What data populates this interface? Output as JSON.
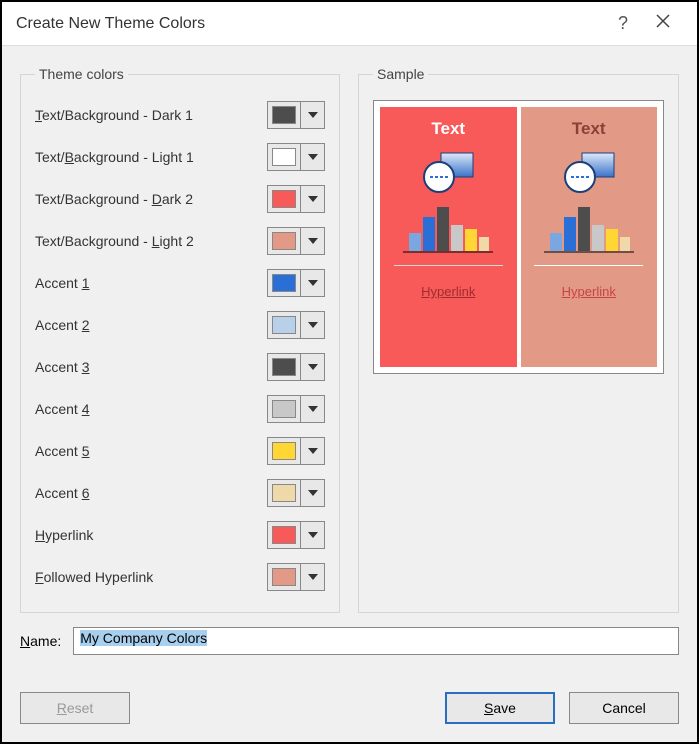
{
  "dialog": {
    "title": "Create New Theme Colors"
  },
  "themeColors": {
    "legend": "Theme colors",
    "items": [
      {
        "pre": "",
        "u": "T",
        "post": "ext/Background - Dark 1",
        "color": "#4d4d4d"
      },
      {
        "pre": "Text/",
        "u": "B",
        "post": "ackground - Light 1",
        "color": "#ffffff"
      },
      {
        "pre": "Text/Background - ",
        "u": "D",
        "post": "ark 2",
        "color": "#f85a5a"
      },
      {
        "pre": "Text/Background - ",
        "u": "L",
        "post": "ight 2",
        "color": "#e29a87"
      },
      {
        "pre": "Accent ",
        "u": "1",
        "post": "",
        "color": "#2a6fd6"
      },
      {
        "pre": "Accent ",
        "u": "2",
        "post": "",
        "color": "#b9d0ea"
      },
      {
        "pre": "Accent ",
        "u": "3",
        "post": "",
        "color": "#4d4d4d"
      },
      {
        "pre": "Accent ",
        "u": "4",
        "post": "",
        "color": "#c8c8c8"
      },
      {
        "pre": "Accent ",
        "u": "5",
        "post": "",
        "color": "#ffd633"
      },
      {
        "pre": "Accent ",
        "u": "6",
        "post": "",
        "color": "#f0d9a8"
      },
      {
        "pre": "",
        "u": "H",
        "post": "yperlink",
        "color": "#f85a5a"
      },
      {
        "pre": "",
        "u": "F",
        "post": "ollowed Hyperlink",
        "color": "#e29a87"
      }
    ]
  },
  "sample": {
    "legend": "Sample",
    "panelA": {
      "bg": "#f85a5a",
      "text": "Text",
      "textColor": "#ffffff",
      "divColor": "#d9d9d9",
      "hyper": "Hyperlink",
      "hyperColor": "#9e2d2d"
    },
    "panelB": {
      "bg": "#e29a87",
      "text": "Text",
      "textColor": "#8c3f36",
      "divColor": "#ffffff",
      "hyper": "Hyperlink",
      "hyperColor": "#c84444"
    }
  },
  "name": {
    "label_u": "N",
    "label_post": "ame:",
    "value": "My Company Colors"
  },
  "buttons": {
    "reset_u": "R",
    "reset_post": "eset",
    "save_u": "S",
    "save_post": "ave",
    "cancel": "Cancel"
  }
}
